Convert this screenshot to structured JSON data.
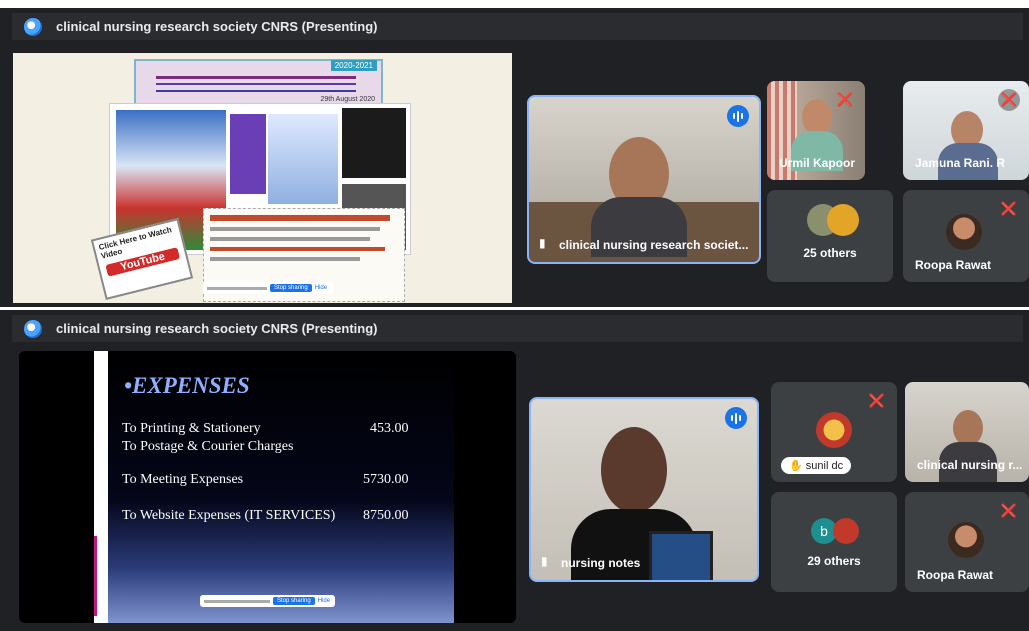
{
  "top_panel": {
    "title": "clinical nursing research society CNRS (Presenting)",
    "slide": {
      "year_badge": "2020-2021",
      "webinar_date": "29th August 2020",
      "youtube_text": "Click Here to Watch Video",
      "youtube_brand": "YouTube",
      "stop_sharing": "Stop sharing",
      "hide": "Hide"
    },
    "featured": {
      "name": "clinical nursing research societ..."
    },
    "tiles": [
      {
        "name": "Urmil Kapoor"
      },
      {
        "name": "Jamuna Rani. R"
      },
      {
        "label": "25 others"
      },
      {
        "name": "Roopa Rawat"
      }
    ]
  },
  "bottom_panel": {
    "title": "clinical nursing research society CNRS (Presenting)",
    "slide": {
      "heading": "•EXPENSES",
      "rows": [
        {
          "label": "To Printing & Stationery",
          "amount": "453.00"
        },
        {
          "label": "To Postage & Courier Charges",
          "amount": ""
        },
        {
          "label": "To Meeting Expenses",
          "amount": "5730.00"
        },
        {
          "label": "To Website Expenses (IT SERVICES)",
          "amount": "8750.00"
        }
      ],
      "stop_sharing": "Stop sharing",
      "hide": "Hide"
    },
    "featured": {
      "name": "nursing notes"
    },
    "tiles": [
      {
        "name": "sunil dc"
      },
      {
        "name": "clinical nursing r..."
      },
      {
        "label": "29 others",
        "avatar_letter": "b"
      },
      {
        "name": "Roopa Rawat"
      }
    ]
  },
  "colors": {
    "call_bg": "#202124",
    "tile_bg": "#3c4043",
    "accent": "#1a73e8"
  }
}
